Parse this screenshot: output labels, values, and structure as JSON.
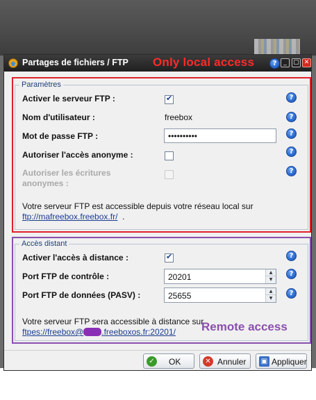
{
  "window": {
    "title": "Partages de fichiers / FTP",
    "icon": "freebox-share-icon",
    "controls": [
      "?",
      "_",
      "▢",
      "✕"
    ]
  },
  "annotations": {
    "local": "Only local access",
    "remote": "Remote access",
    "local_color": "#e0202a",
    "remote_color": "#8a4fae"
  },
  "params": {
    "legend": "Paramètres",
    "enable_ftp_label": "Activer le serveur FTP :",
    "enable_ftp_checked": true,
    "username_label": "Nom d'utilisateur :",
    "username_value": "freebox",
    "password_label": "Mot de passe FTP :",
    "password_value": "••••••••••",
    "anonymous_label": "Autoriser l'accès anonyme :",
    "anonymous_checked": false,
    "anon_write_label_1": "Autoriser les écritures",
    "anon_write_label_2": "anonymes :",
    "anon_write_checked": false,
    "info_text": "Votre serveur FTP est accessible depuis votre réseau local sur",
    "link": "ftp://mafreebox.freebox.fr/",
    "link_suffix": "."
  },
  "remote": {
    "legend": "Accès distant",
    "enable_remote_label": "Activer l'accès à distance :",
    "enable_remote_checked": true,
    "control_port_label": "Port FTP de contrôle :",
    "control_port_value": "20201",
    "data_port_label": "Port FTP de données (PASV) :",
    "data_port_value": "25655",
    "info_text": "Votre serveur FTP sera accessible à distance sur",
    "link_prefix": "ftpes://freebox@",
    "link_suffix": ".freeboxos.fr:20201/"
  },
  "buttons": {
    "ok": "OK",
    "cancel": "Annuler",
    "apply": "Appliquer"
  }
}
